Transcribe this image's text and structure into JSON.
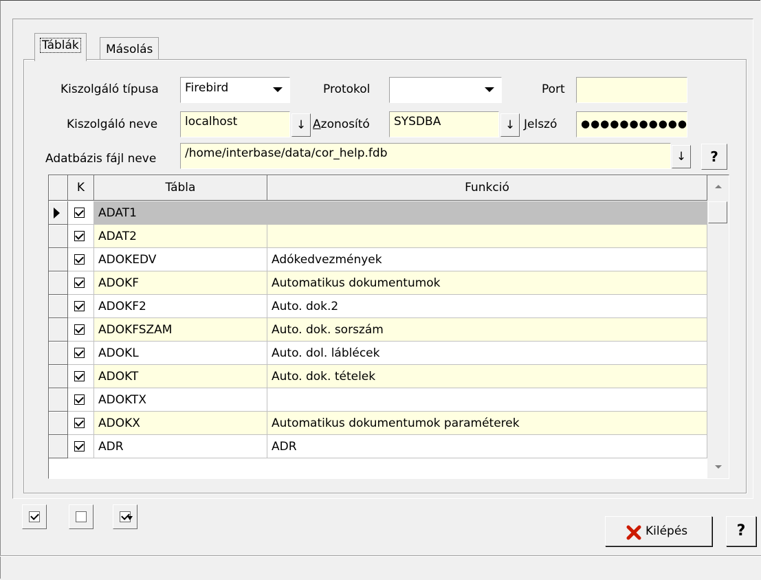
{
  "tabs": [
    "Táblák",
    "Másolás"
  ],
  "form": {
    "server_type_label": "Kiszolgáló típusa",
    "server_type_value": "Firebird",
    "protocol_label": "Protokol",
    "protocol_value": "",
    "port_label": "Port",
    "port_value": "",
    "server_name_label": "Kiszolgáló neve",
    "server_name_value": "localhost",
    "user_label_prefix": "A",
    "user_label_rest": "zonosító",
    "user_value": "SYSDBA",
    "password_label_prefix": "J",
    "password_label_rest": "elszó",
    "password_value": "●●●●●●●●●●●",
    "db_file_label": "Adatbázis fájl neve",
    "db_file_value": "/home/interbase/data/cor_help.fdb",
    "down_arrow_glyph": "↓",
    "help_glyph": "?"
  },
  "grid": {
    "headers": [
      "K",
      "Tábla",
      "Funkció"
    ],
    "rows": [
      {
        "checked": true,
        "table": "ADAT1",
        "func": ""
      },
      {
        "checked": true,
        "table": "ADAT2",
        "func": ""
      },
      {
        "checked": true,
        "table": "ADOKEDV",
        "func": "Adókedvezmények"
      },
      {
        "checked": true,
        "table": "ADOKF",
        "func": "Automatikus dokumentumok"
      },
      {
        "checked": true,
        "table": "ADOKF2",
        "func": "Auto. dok.2"
      },
      {
        "checked": true,
        "table": "ADOKFSZAM",
        "func": "Auto. dok. sorszám"
      },
      {
        "checked": true,
        "table": "ADOKL",
        "func": "Auto. dol. láblécek"
      },
      {
        "checked": true,
        "table": "ADOKT",
        "func": "Auto. dok. tételek"
      },
      {
        "checked": true,
        "table": "ADOKTX",
        "func": ""
      },
      {
        "checked": true,
        "table": "ADOKX",
        "func": "Automatikus dokumentumok paraméterek"
      },
      {
        "checked": true,
        "table": "ADR",
        "func": "ADR"
      }
    ],
    "selected_row": 0
  },
  "buttons": {
    "exit_label": "Kilépés",
    "help_label": "?"
  },
  "colors": {
    "field_bg": "#ffffe1",
    "alt_row_bg": "#ffffe1",
    "selected_row_bg": "#c0c0c0",
    "exit_icon": "#cc1a00"
  }
}
